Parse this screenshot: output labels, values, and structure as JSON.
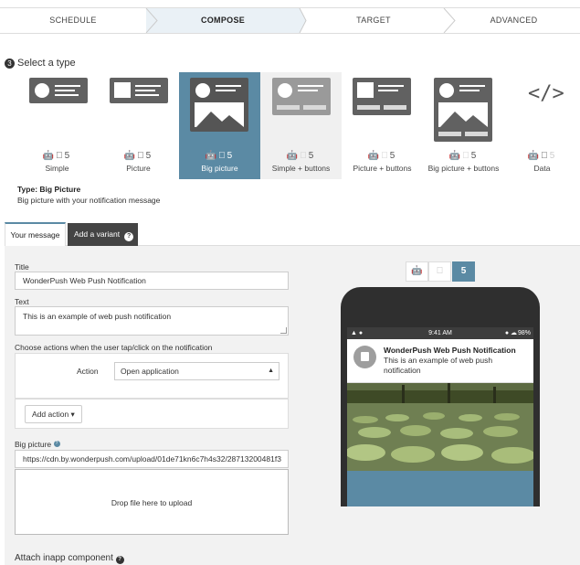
{
  "wizard": {
    "steps": [
      {
        "label": "SCHEDULE",
        "active": false
      },
      {
        "label": "COMPOSE",
        "active": true
      },
      {
        "label": "TARGET",
        "active": false
      },
      {
        "label": "ADVANCED",
        "active": false
      }
    ]
  },
  "type_section": {
    "number": "3",
    "title": "Select a type",
    "tiles": [
      {
        "label": "Simple",
        "selected": false
      },
      {
        "label": "Picture",
        "selected": false
      },
      {
        "label": "Big picture",
        "selected": true
      },
      {
        "label": "Simple + buttons",
        "selected": false
      },
      {
        "label": "Picture + buttons",
        "selected": false
      },
      {
        "label": "Big picture + buttons",
        "selected": false
      },
      {
        "label": "Data",
        "selected": false
      }
    ],
    "selected_type_name": "Type: Big Picture",
    "selected_type_desc": "Big picture with your notification message"
  },
  "tabs": {
    "your_message": "Your message",
    "add_variant": "Add a variant",
    "help_glyph": "?"
  },
  "form": {
    "title_label": "Title",
    "title_value": "WonderPush Web Push Notification",
    "text_label": "Text",
    "text_value": "This is an example of web push notification",
    "actions_label": "Choose actions when the user tap/click on the notification",
    "action_label": "Action",
    "action_value": "Open application",
    "add_action": "Add action",
    "big_picture_label": "Big picture",
    "big_picture_value": "https://cdn.by.wonderpush.com/upload/01de71kn6c7h4s32/28713200481f3",
    "drop_text": "Drop file here to upload",
    "inapp_label": "Attach inapp component",
    "inapp_help": "?"
  },
  "preview": {
    "platforms": [
      {
        "name": "android-icon",
        "active": false
      },
      {
        "name": "apple-icon",
        "active": false
      },
      {
        "name": "html5-icon",
        "active": true
      }
    ],
    "time": "9:41 AM",
    "battery": "98%",
    "notif_title": "WonderPush Web Push Notification",
    "notif_body": "This is an example of web push notification"
  },
  "colors": {
    "accent": "#5b8aa4",
    "dark": "#444444",
    "panel": "#f2f2f2"
  }
}
